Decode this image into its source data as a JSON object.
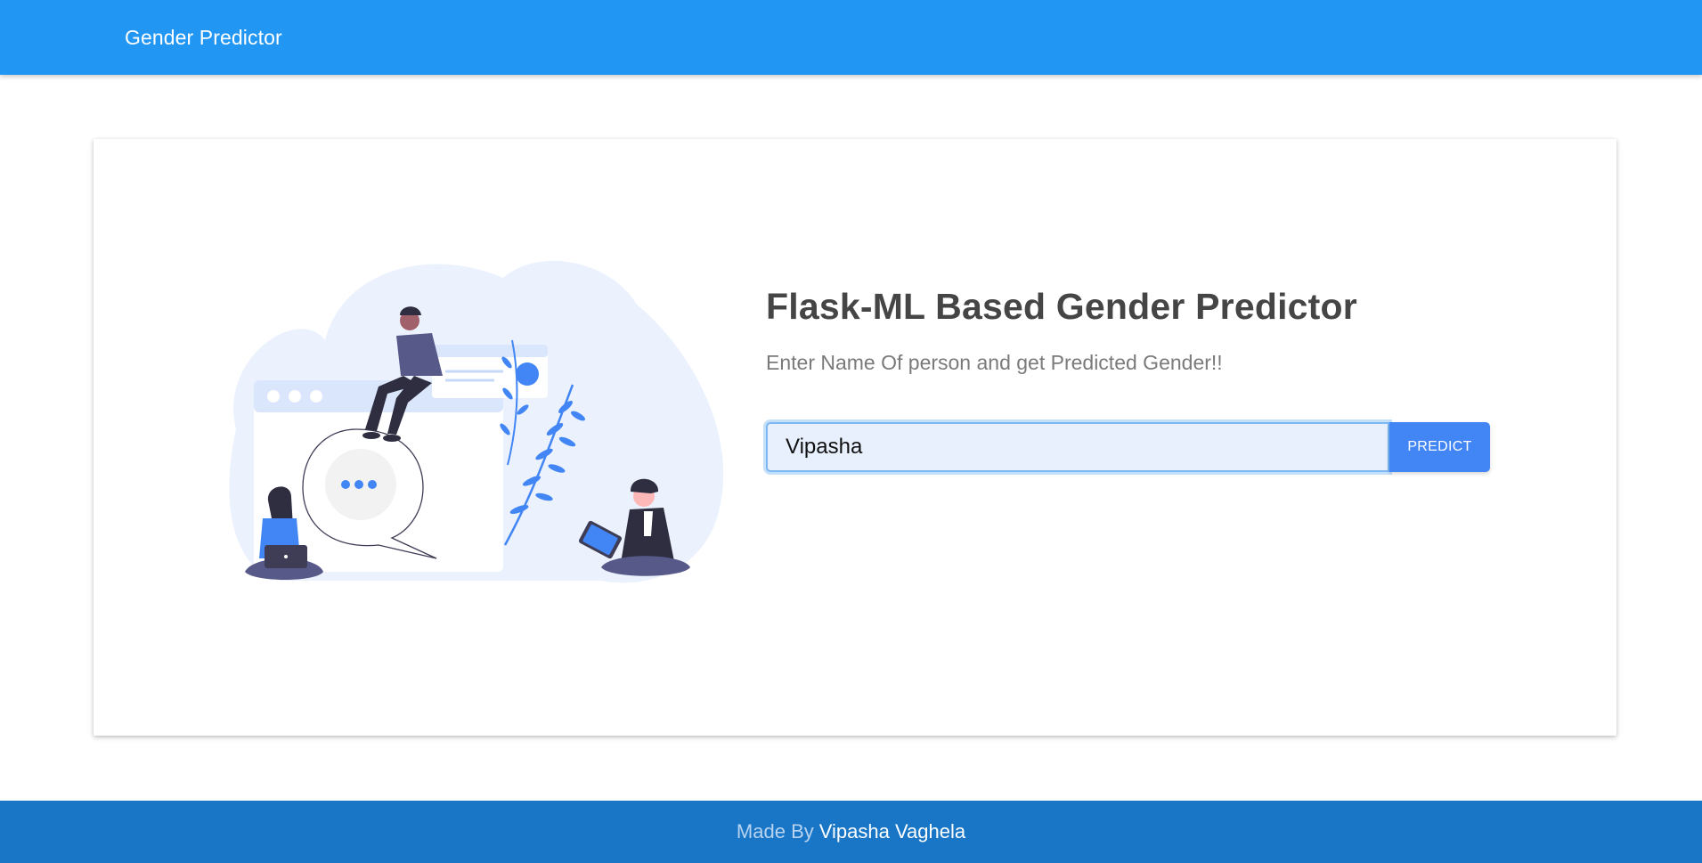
{
  "navbar": {
    "brand": "Gender Predictor",
    "color": "#2196f3"
  },
  "hero": {
    "title": "Flask-ML Based Gender Predictor",
    "subtitle": "Enter Name Of person and get Predicted Gender!!",
    "illustration_icon": "people-chat-illustration"
  },
  "form": {
    "name_value": "Vipasha",
    "predict_label": "PREDICT",
    "button_color": "#4285f4"
  },
  "footer": {
    "made_by": "Made By",
    "author": "Vipasha Vaghela",
    "color": "#1976c7"
  }
}
